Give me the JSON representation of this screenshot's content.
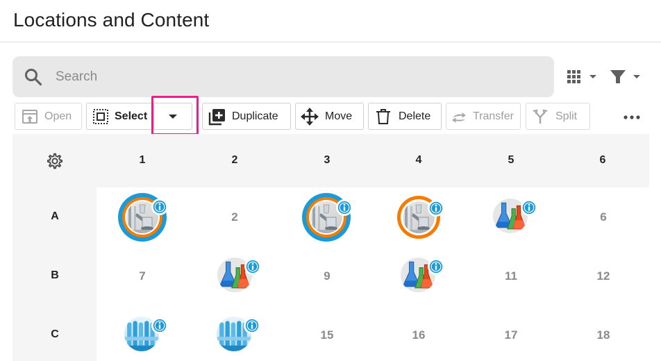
{
  "page": {
    "title": "Locations and Content"
  },
  "search": {
    "placeholder": "Search",
    "value": ""
  },
  "toolbar": {
    "open_label": "Open",
    "select_label": "Select",
    "duplicate_label": "Duplicate",
    "move_label": "Move",
    "delete_label": "Delete",
    "transfer_label": "Transfer",
    "split_label": "Split"
  },
  "grid": {
    "columns": [
      "1",
      "2",
      "3",
      "4",
      "5",
      "6"
    ],
    "rows": [
      "A",
      "B",
      "C"
    ],
    "cells": {
      "A2": "2",
      "A6": "6",
      "B1": "7",
      "B3": "9",
      "B5": "11",
      "B6": "12",
      "C3": "15",
      "C4": "16",
      "C5": "17",
      "C6": "18"
    },
    "occupied": [
      {
        "cell": "A1",
        "image": "lab-glassware",
        "ring": "blue-orange"
      },
      {
        "cell": "A3",
        "image": "lab-glassware",
        "ring": "blue-orange"
      },
      {
        "cell": "A4",
        "image": "lab-glassware",
        "ring": "orange"
      },
      {
        "cell": "A5",
        "image": "flasks"
      },
      {
        "cell": "B2",
        "image": "flasks"
      },
      {
        "cell": "B4",
        "image": "flasks"
      },
      {
        "cell": "C1",
        "image": "test-tubes"
      },
      {
        "cell": "C2",
        "image": "test-tubes"
      }
    ]
  },
  "colors": {
    "accent": "#1a9bd7",
    "ring_orange": "#f57c00",
    "highlight": "#ec1d8c"
  }
}
